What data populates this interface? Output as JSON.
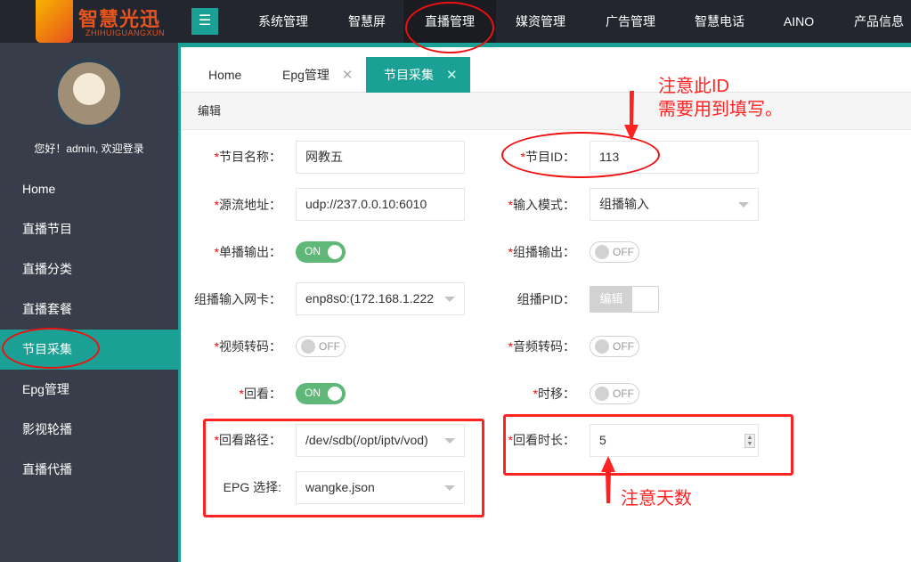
{
  "header": {
    "logo_text": "智慧光迅",
    "logo_subtext": "ZHIHUIGUANGXUN",
    "menu_icon": "☰",
    "nav": [
      "系统管理",
      "智慧屏",
      "直播管理",
      "媒资管理",
      "广告管理",
      "智慧电话",
      "AINO",
      "产品信息"
    ],
    "active_nav": "直播管理"
  },
  "sidebar": {
    "greeting": "您好！admin, 欢迎登录",
    "items": [
      "Home",
      "直播节目",
      "直播分类",
      "直播套餐",
      "节目采集",
      "Epg管理",
      "影视轮播",
      "直播代播"
    ],
    "active": "节目采集"
  },
  "tabs": [
    {
      "label": "Home"
    },
    {
      "label": "Epg管理",
      "close": "✕"
    },
    {
      "label": "节目采集",
      "close": "✕",
      "active": true
    }
  ],
  "panel": {
    "title": "编辑"
  },
  "form": {
    "name": {
      "label": "节目名称：",
      "value": "网教五"
    },
    "id": {
      "label": "节目ID：",
      "value": "113"
    },
    "source": {
      "label": "源流地址：",
      "value": "udp://237.0.0.10:6010"
    },
    "input_mode": {
      "label": "输入模式：",
      "value": "组播输入"
    },
    "unicast": {
      "label": "单播输出：",
      "state": "ON"
    },
    "multicast": {
      "label": "组播输出：",
      "state": "OFF"
    },
    "nic": {
      "label": "组播输入网卡：",
      "value": "enp8s0:(172.168.1.222"
    },
    "pid": {
      "label": "组播PID：",
      "button": "编辑"
    },
    "video": {
      "label": "视频转码：",
      "state": "OFF"
    },
    "audio": {
      "label": "音频转码：",
      "state": "OFF"
    },
    "playback": {
      "label": "回看：",
      "state": "ON"
    },
    "timeshift": {
      "label": "时移：",
      "state": "OFF"
    },
    "path": {
      "label": "回看路径：",
      "value": "/dev/sdb(/opt/iptv/vod)"
    },
    "duration": {
      "label": "回看时长：",
      "value": "5"
    },
    "epg": {
      "label": "EPG 选择:",
      "value": "wangke.json"
    },
    "required_mark": "*"
  },
  "annotations": {
    "id_note_line1": "注意此ID",
    "id_note_line2": "需要用到填写。",
    "days_note": "注意天数",
    "color": "#ff2222"
  },
  "colors": {
    "accent": "#1aa094",
    "topbar": "#23262e",
    "sidebar": "#393d49",
    "switch_on": "#5fb878"
  }
}
